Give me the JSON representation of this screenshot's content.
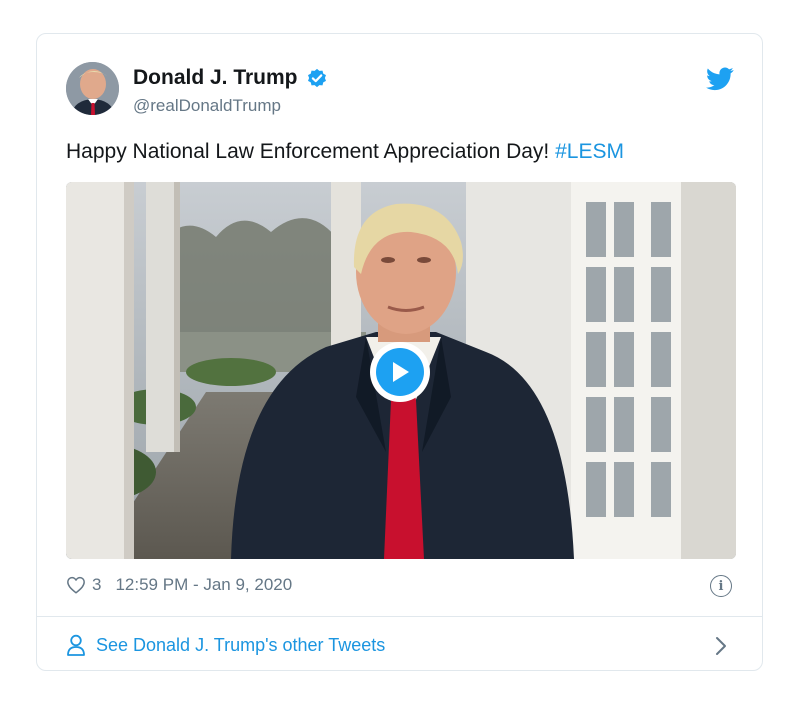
{
  "author": {
    "name": "Donald J. Trump",
    "handle": "@realDonaldTrump"
  },
  "tweet": {
    "text": "Happy National Law Enforcement Appreciation Day!",
    "hashtag": "#LESM"
  },
  "meta": {
    "likes": "3",
    "timestamp": "12:59 PM - Jan 9, 2020"
  },
  "footer": {
    "link_label": "See Donald J. Trump's other Tweets"
  },
  "icons": [
    "verified-badge-icon",
    "twitter-bird-icon",
    "play-icon",
    "heart-icon",
    "info-icon",
    "person-icon",
    "chevron-right-icon"
  ],
  "colors": {
    "brand": "#1da1f2",
    "link": "#1b95e0",
    "text": "#14171a",
    "muted": "#657786",
    "border": "#e1e8ed"
  }
}
